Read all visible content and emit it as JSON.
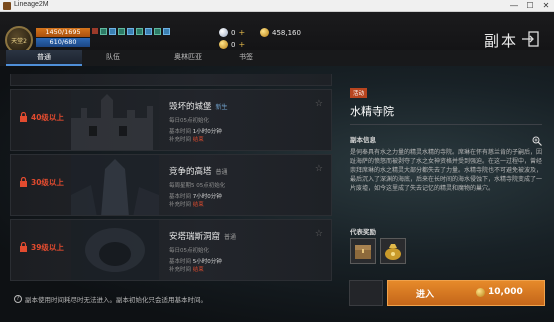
{
  "window": {
    "title": "Lineage2M",
    "min": "—",
    "max": "☐",
    "close": "✕"
  },
  "hud": {
    "avatar_text": "天堂2",
    "hp": "1450/1695",
    "mp": "610/680",
    "silver_count": "0",
    "gold_count": "458,160",
    "gold2_count": "0",
    "page_title": "副本"
  },
  "tabs": [
    {
      "label": "普通"
    },
    {
      "label": "队伍"
    },
    {
      "label": "奥林匹亚"
    },
    {
      "label": "书签"
    }
  ],
  "dungeons": [
    {
      "level": "40级以上",
      "name": "毁坏的城堡",
      "tag": "新生",
      "reset": "每日05点初始化",
      "base_label": "基本时间",
      "base_value": "1小时0分钟",
      "charge_label": "补充时间",
      "charge_value": "结束"
    },
    {
      "level": "30级以上",
      "name": "竞争的高塔",
      "tag": "普通",
      "reset": "每周星期5 05点初始化",
      "base_label": "基本时间",
      "base_value": "7小时0分钟",
      "charge_label": "补充时间",
      "charge_value": "结束"
    },
    {
      "level": "39级以上",
      "name": "安塔瑞斯洞窟",
      "tag": "普通",
      "reset": "每日05点初始化",
      "base_label": "基本时间",
      "base_value": "5小时0分钟",
      "charge_label": "补充时间",
      "charge_value": "结束"
    }
  ],
  "footer_note": "副本使用时间耗尽时无法进入。副本初始化只会适用基本时间。",
  "detail": {
    "badge": "活动",
    "title": "水精寺院",
    "info_heading": "副本信息",
    "description": "是伺奉具有水之力量的精灵水精的寺院。席琳在怀有慈兰肯的子嗣后，因趾海萨的愤怒而被剥夺了水之女神资格并受到强迫。在这一过程中，曾经崇拜席琳的水之精灵大部分都失去了力量。水精寺院也不可避免被波及，最后沉入了深渊的海底，后来在长时间的海水侵蚀下，水精寺院变成了一片废墟，如今这里成了失去记忆的精灵和魔物的巢穴。",
    "reward_heading": "代表奖励",
    "enter_label": "进入",
    "price": "10,000"
  }
}
